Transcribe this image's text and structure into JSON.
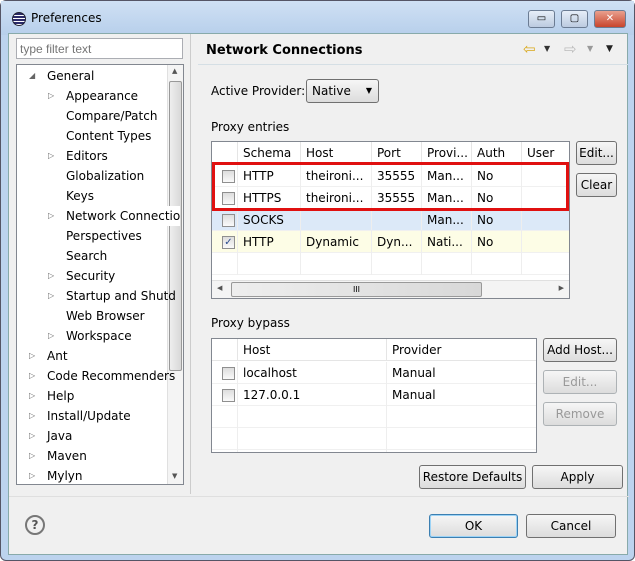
{
  "window": {
    "title": "Preferences",
    "minimize": "▭",
    "maximize": "▢",
    "close": "✕"
  },
  "filter": {
    "placeholder": "type filter text"
  },
  "tree": [
    {
      "label": "General",
      "level": 0,
      "expander": "open"
    },
    {
      "label": "Appearance",
      "level": 1,
      "expander": "closed"
    },
    {
      "label": "Compare/Patch",
      "level": 1,
      "expander": ""
    },
    {
      "label": "Content Types",
      "level": 1,
      "expander": ""
    },
    {
      "label": "Editors",
      "level": 1,
      "expander": "closed"
    },
    {
      "label": "Globalization",
      "level": 1,
      "expander": ""
    },
    {
      "label": "Keys",
      "level": 1,
      "expander": ""
    },
    {
      "label": "Network Connectio",
      "level": 1,
      "expander": "closed",
      "selected": true
    },
    {
      "label": "Perspectives",
      "level": 1,
      "expander": ""
    },
    {
      "label": "Search",
      "level": 1,
      "expander": ""
    },
    {
      "label": "Security",
      "level": 1,
      "expander": "closed"
    },
    {
      "label": "Startup and Shutd",
      "level": 1,
      "expander": "closed"
    },
    {
      "label": "Web Browser",
      "level": 1,
      "expander": ""
    },
    {
      "label": "Workspace",
      "level": 1,
      "expander": "closed"
    },
    {
      "label": "Ant",
      "level": 0,
      "expander": "closed"
    },
    {
      "label": "Code Recommenders",
      "level": 0,
      "expander": "closed"
    },
    {
      "label": "Help",
      "level": 0,
      "expander": "closed"
    },
    {
      "label": "Install/Update",
      "level": 0,
      "expander": "closed"
    },
    {
      "label": "Java",
      "level": 0,
      "expander": "closed"
    },
    {
      "label": "Maven",
      "level": 0,
      "expander": "closed"
    },
    {
      "label": "Mylyn",
      "level": 0,
      "expander": "closed"
    }
  ],
  "page": {
    "title": "Network Connections",
    "back_icon": "⇦",
    "forward_icon": "⇨",
    "menu_icon": "▼"
  },
  "provider": {
    "label": "Active Provider:",
    "value": "Native"
  },
  "proxy_entries": {
    "label": "Proxy entries",
    "columns": [
      "Schema",
      "Host",
      "Port",
      "Provi...",
      "Auth",
      "User"
    ],
    "rows": [
      {
        "checked": false,
        "cells": [
          "HTTP",
          "theironi...",
          "35555",
          "Man...",
          "No",
          ""
        ]
      },
      {
        "checked": false,
        "cells": [
          "HTTPS",
          "theironi...",
          "35555",
          "Man...",
          "No",
          ""
        ]
      },
      {
        "checked": false,
        "cells": [
          "SOCKS",
          "",
          "",
          "Man...",
          "No",
          ""
        ]
      },
      {
        "checked": true,
        "cells": [
          "HTTP",
          "Dynamic",
          "Dyn...",
          "Nati...",
          "No",
          ""
        ]
      }
    ],
    "edit": "Edit...",
    "clear": "Clear",
    "scroll_grip": "III",
    "highlight_color": "#e01010"
  },
  "proxy_bypass": {
    "label": "Proxy bypass",
    "columns": [
      "Host",
      "Provider"
    ],
    "rows": [
      {
        "checked": false,
        "cells": [
          "localhost",
          "Manual"
        ]
      },
      {
        "checked": false,
        "cells": [
          "127.0.0.1",
          "Manual"
        ]
      }
    ],
    "add_host": "Add Host...",
    "edit": "Edit...",
    "remove": "Remove"
  },
  "restore_defaults": "Restore Defaults",
  "apply": "Apply",
  "help_icon": "?",
  "ok": "OK",
  "cancel": "Cancel"
}
